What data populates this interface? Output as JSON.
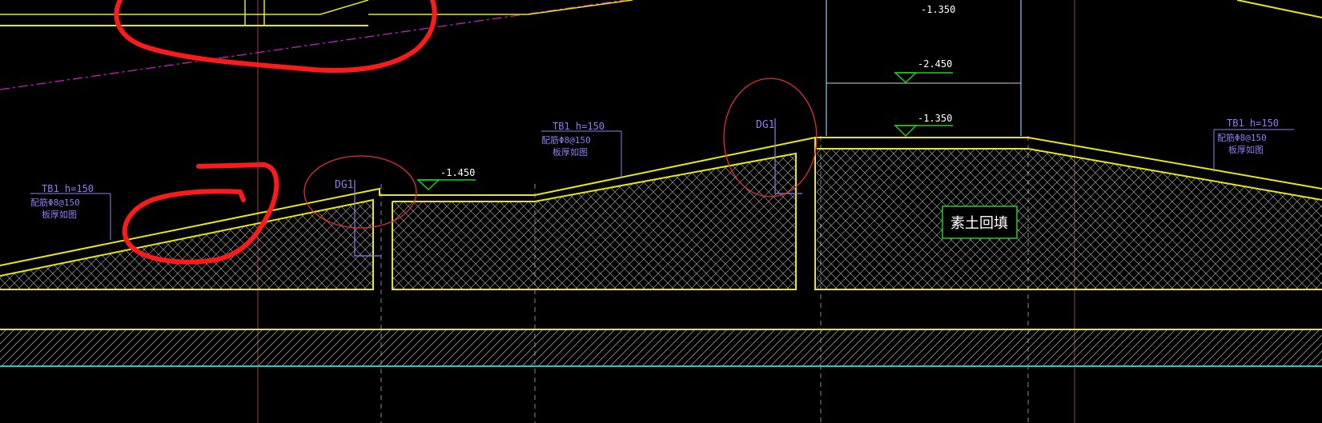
{
  "drawing": {
    "elevations": {
      "top": "-1.350",
      "mid": "-2.450",
      "bottom": "-1.350",
      "ramp": "-1.450"
    },
    "dg_tags": {
      "left": "DG1",
      "right": "DG1"
    },
    "tb_labels": {
      "left": {
        "title": "TB1  h=150",
        "line1": "配筋Φ8@150",
        "line2": "板厚如图"
      },
      "mid": {
        "title": "TB1  h=150",
        "line1": "配筋Φ8@150",
        "line2": "板厚如图"
      },
      "right": {
        "title": "TB1  h=150",
        "line1": "配筋Φ8@150",
        "line2": "板厚如图"
      }
    },
    "fill_label": "素土回填"
  },
  "colors": {
    "background": "#000000",
    "structure": "#e6e61a",
    "annotation": "#8f7cf0",
    "markup": "#ff1a1a",
    "level": "#22cc22",
    "gridline": "#a04040",
    "cyan": "#22c8c8",
    "magenta": "#c020c0",
    "column": "#6a9fd0"
  }
}
